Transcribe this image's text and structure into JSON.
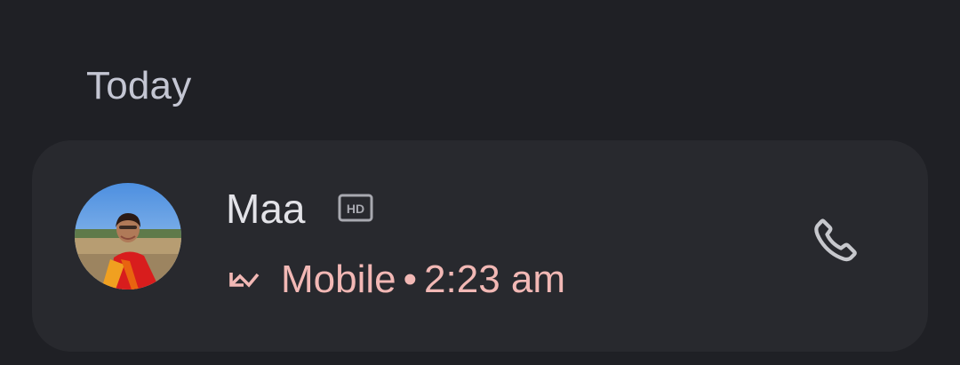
{
  "section": {
    "header": "Today"
  },
  "call": {
    "contact_name": "Maa",
    "hd_badge_text": "HD",
    "call_type": "Mobile",
    "separator": "•",
    "time": "2:23 am",
    "status_icon": "missed-call-icon",
    "action_icon": "phone-icon"
  },
  "colors": {
    "background": "#1f2025",
    "card": "#28292e",
    "missed_text": "#f2b8b5",
    "header_text": "#c4c6d3"
  }
}
